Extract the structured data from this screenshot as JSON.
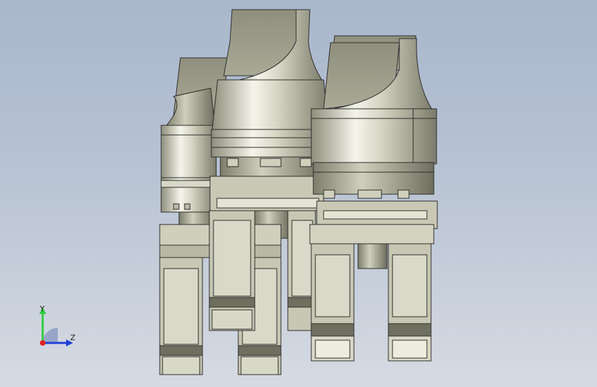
{
  "viewport": {
    "background_top": "#a9b7cc",
    "background_bottom": "#d6dbe3",
    "model_color": "#c9c9b4",
    "model_edge_color": "#2b2b2b"
  },
  "triad": {
    "y_label": "Y",
    "z_label": "Z",
    "y_color": "#2ecc40",
    "z_color": "#1f3fd6",
    "x_color": "#e02020"
  }
}
